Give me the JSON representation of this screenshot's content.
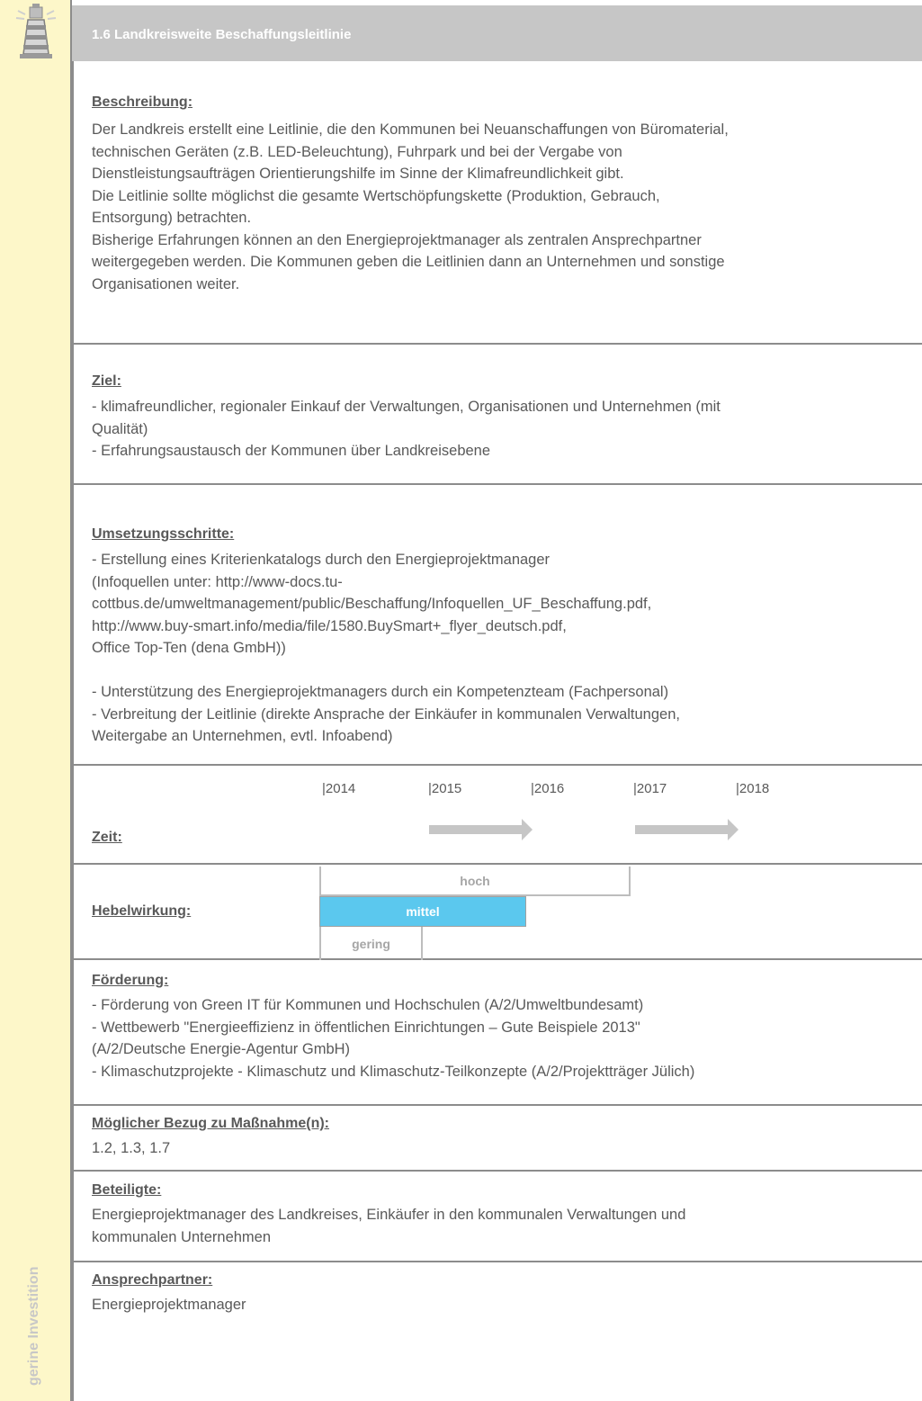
{
  "sidebar": {
    "icon": "lighthouse-icon",
    "vertical_label": "gerine Investition"
  },
  "header": {
    "title": "1.6 Landkreisweite Beschaffungsleitlinie"
  },
  "beschreibung": {
    "heading": "Beschreibung:",
    "lines": [
      "Der Landkreis erstellt eine Leitlinie, die den Kommunen bei Neuanschaffungen von Büromaterial,",
      "technischen Geräten (z.B. LED-Beleuchtung), Fuhrpark und bei der Vergabe von",
      "Dienstleistungsaufträgen Orientierungshilfe im Sinne der Klimafreundlichkeit gibt.",
      "Die Leitlinie sollte möglichst die gesamte Wertschöpfungskette (Produktion, Gebrauch,",
      "Entsorgung) betrachten.",
      "Bisherige Erfahrungen können an den Energieprojektmanager als zentralen Ansprechpartner",
      "weitergegeben werden. Die Kommunen geben die Leitlinien dann an Unternehmen und sonstige",
      "Organisationen weiter."
    ]
  },
  "ziel": {
    "heading": "Ziel:",
    "lines": [
      "- klimafreundlicher, regionaler Einkauf der Verwaltungen, Organisationen und Unternehmen (mit",
      "Qualität)",
      "- Erfahrungsaustausch der Kommunen über Landkreisebene"
    ]
  },
  "umsetzung": {
    "heading": "Umsetzungsschritte:",
    "lines": [
      "- Erstellung eines Kriterienkatalogs durch den Energieprojektmanager",
      "(Infoquellen unter: http://www-docs.tu-",
      "cottbus.de/umweltmanagement/public/Beschaffung/Infoquellen_UF_Beschaffung.pdf,",
      "http://www.buy-smart.info/media/file/1580.BuySmart+_flyer_deutsch.pdf,",
      "Office Top-Ten (dena GmbH))",
      "",
      "- Unterstützung des Energieprojektmanagers durch ein Kompetenzteam (Fachpersonal)",
      "- Verbreitung der Leitlinie (direkte Ansprache der Einkäufer in kommunalen Verwaltungen,",
      "Weitergabe an Unternehmen, evtl. Infoabend)"
    ]
  },
  "zeit": {
    "heading": "Zeit:",
    "years": [
      "|2014",
      "|2015",
      "|2016",
      "|2017",
      "|2018"
    ]
  },
  "hebelwirkung": {
    "heading": "Hebelwirkung:",
    "levels": [
      "hoch",
      "mittel",
      "gering"
    ],
    "selected": "mittel",
    "accent_color": "#5bc8ee"
  },
  "foerderung": {
    "heading": "Förderung:",
    "lines": [
      "- Förderung von Green IT für Kommunen und Hochschulen (A/2/Umweltbundesamt)",
      "- Wettbewerb \"Energieeffizienz in öffentlichen Einrichtungen – Gute Beispiele 2013\"",
      "(A/2/Deutsche Energie-Agentur GmbH)",
      "- Klimaschutzprojekte - Klimaschutz und Klimaschutz-Teilkonzepte (A/2/Projektträger Jülich)"
    ]
  },
  "bezug": {
    "heading": "Möglicher Bezug zu Maßnahme(n):",
    "lines": [
      "1.2, 1.3, 1.7"
    ]
  },
  "beteiligte": {
    "heading": "Beteiligte:",
    "lines": [
      "Energieprojektmanager des Landkreises, Einkäufer in den kommunalen Verwaltungen und",
      "kommunalen Unternehmen"
    ]
  },
  "ansprechpartner": {
    "heading": "Ansprechpartner:",
    "lines": [
      "Energieprojektmanager"
    ]
  }
}
